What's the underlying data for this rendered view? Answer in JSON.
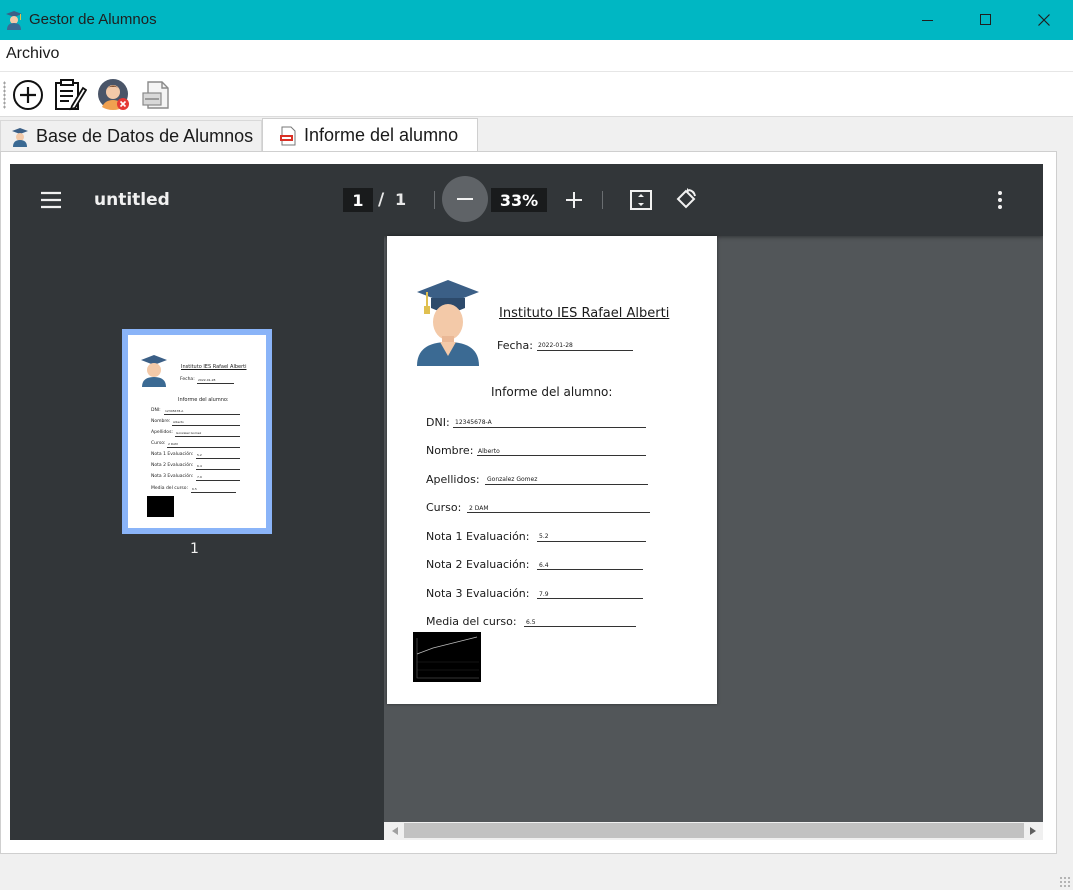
{
  "window": {
    "title": "Gestor de Alumnos",
    "accent": "#00b7c3"
  },
  "menu": {
    "items": [
      {
        "label": "Archivo"
      }
    ]
  },
  "toolbar": {
    "buttons": [
      {
        "icon": "add-circle-icon"
      },
      {
        "icon": "edit-document-icon"
      },
      {
        "icon": "delete-user-icon"
      },
      {
        "icon": "report-icon"
      }
    ]
  },
  "tabs": [
    {
      "label": "Base de Datos de Alumnos",
      "icon": "student-icon",
      "active": false
    },
    {
      "label": "Informe del alumno",
      "icon": "pdf-icon",
      "active": true
    }
  ],
  "viewer": {
    "doc_title": "untitled",
    "page_current": "1",
    "page_sep": "/",
    "page_total": "1",
    "zoom": "33%",
    "thumbnail_label": "1"
  },
  "report": {
    "institute": "Instituto IES Rafael Alberti",
    "date_label": "Fecha:",
    "date_value": "2022-01-28",
    "heading": "Informe del alumno:",
    "fields": [
      {
        "label": "DNI:",
        "value": "12345678-A"
      },
      {
        "label": "Nombre:",
        "value": "Alberto"
      },
      {
        "label": "Apellidos:",
        "value": "Gonzalez Gomez"
      },
      {
        "label": "Curso:",
        "value": "2 DAM"
      },
      {
        "label": "Nota 1 Evaluación:",
        "value": "5.2"
      },
      {
        "label": "Nota 2 Evaluación:",
        "value": "6.4"
      },
      {
        "label": "Nota 3 Evaluación:",
        "value": "7.9"
      },
      {
        "label": "Media del curso:",
        "value": "6.5"
      }
    ]
  }
}
